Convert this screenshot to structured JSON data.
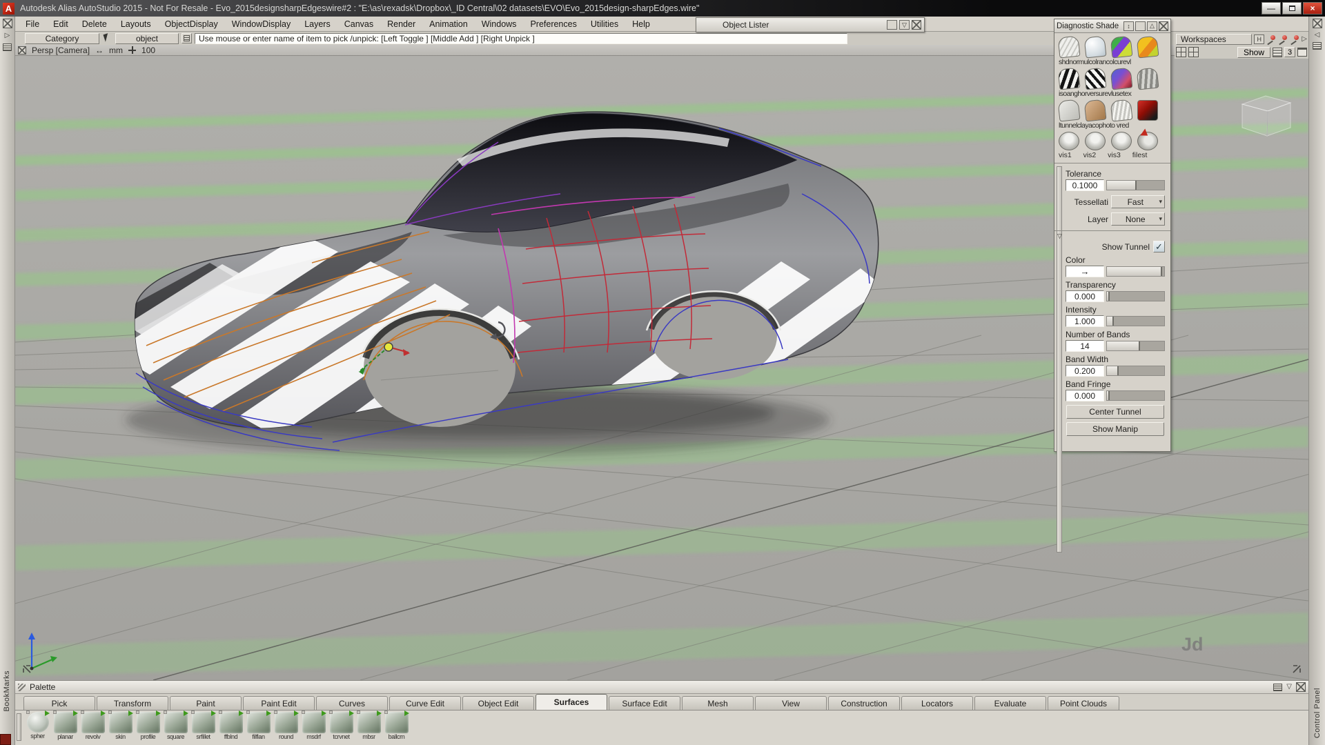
{
  "window": {
    "logo": "A",
    "title": "Autodesk Alias AutoStudio 2015  - Not For Resale   - Evo_2015designsharpEdgeswire#2 : \"E:\\as\\rexadsk\\Dropbox\\_ID Central\\02 datasets\\EVO\\Evo_2015design-sharpEdges.wire\""
  },
  "menu": {
    "items": [
      "File",
      "Edit",
      "Delete",
      "Layouts",
      "ObjectDisplay",
      "WindowDisplay",
      "Layers",
      "Canvas",
      "Render",
      "Animation",
      "Windows",
      "Preferences",
      "Utilities",
      "Help"
    ]
  },
  "toolbar": {
    "category": "Category",
    "object": "object",
    "prompt": "Use mouse or enter name of item to pick /unpick: [Left Toggle ] [Middle Add ] [Right Unpick ]"
  },
  "viewport": {
    "camera": "Persp [Camera]",
    "units": "mm",
    "zoom": "100",
    "watermark": "Jd"
  },
  "object_lister": {
    "title": "Object Lister"
  },
  "diag": {
    "title": "Diagnostic Shade",
    "rows": [
      {
        "caption": "shdnormulcolrancolcurevl"
      },
      {
        "caption": "isoanghorversurevlusetex"
      },
      {
        "caption": "ltunnelclayacophoto vred"
      },
      {
        "caption": "vis1 vis2 vis3 filest"
      }
    ],
    "tolerance": {
      "label": "Tolerance",
      "value": "0.1000"
    },
    "tessellation": {
      "label": "Tessellati",
      "value": "Fast"
    },
    "layer": {
      "label": "Layer",
      "value": "None"
    },
    "show_tunnel": {
      "label": "Show Tunnel"
    },
    "color": {
      "label": "Color"
    },
    "transparency": {
      "label": "Transparency",
      "value": "0.000"
    },
    "intensity": {
      "label": "Intensity",
      "value": "1.000"
    },
    "bands": {
      "label": "Number of Bands",
      "value": "14"
    },
    "band_width": {
      "label": "Band Width",
      "value": "0.200"
    },
    "band_fringe": {
      "label": "Band Fringe",
      "value": "0.000"
    },
    "center_tunnel": "Center Tunnel",
    "show_manip": "Show Manip"
  },
  "workspaces": {
    "label": "Workspaces",
    "h": "H",
    "show": "Show",
    "count": "3"
  },
  "palette": {
    "title": "Palette",
    "tabs": [
      "Pick",
      "Transform",
      "Paint",
      "Paint Edit",
      "Curves",
      "Curve Edit",
      "Object Edit",
      "Surfaces",
      "Surface Edit",
      "Mesh",
      "View",
      "Construction",
      "Locators",
      "Evaluate",
      "Point Clouds"
    ],
    "active_tab": "Surfaces",
    "tools": [
      "spher",
      "planar",
      "revolv",
      "skin",
      "profile",
      "square",
      "srfillet",
      "ffblnd",
      "filflan",
      "round",
      "msdrf",
      "tcrvnet",
      "mbsr",
      "ballcrn"
    ]
  },
  "strips": {
    "left": "BookMarks",
    "right": "Control Panel"
  },
  "icons": {
    "check": "✓",
    "dropdown": "▾",
    "collapse": "▽",
    "range": "↔",
    "arrow": "→",
    "tri_right": "▷",
    "tri_left": "◁",
    "updown": "↕",
    "tri_up": "△"
  },
  "colors": {
    "stripe_green": "#8fcf7d",
    "close_red": "#b0271a",
    "titlebar_dark": "#1d1d1f"
  }
}
